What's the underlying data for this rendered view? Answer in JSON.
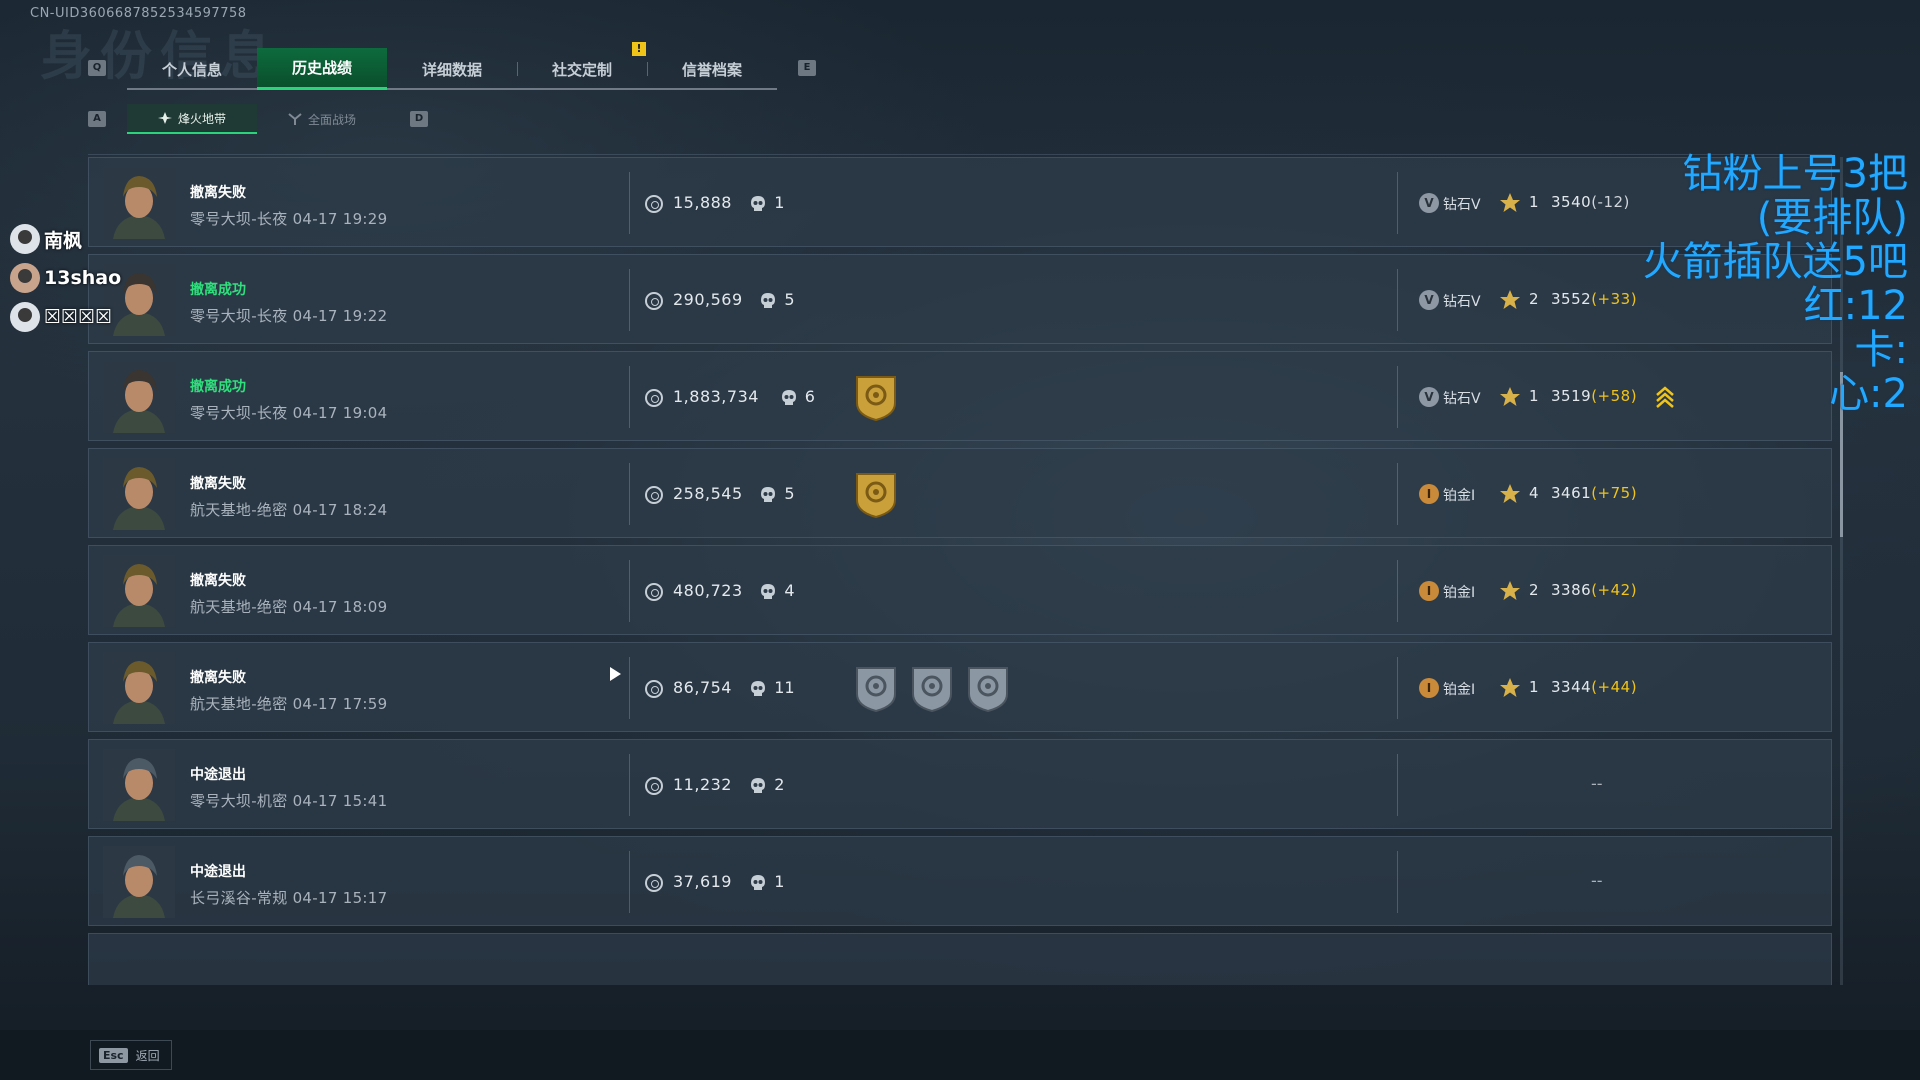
{
  "uid": "CN-UID3606687852534597758",
  "tabs": {
    "key_left": "Q",
    "key_right": "E",
    "items": [
      {
        "label": "个人信息"
      },
      {
        "label": "历史战绩"
      },
      {
        "label": "详细数据"
      },
      {
        "label": "社交定制"
      },
      {
        "label": "信誉档案"
      }
    ],
    "notice": "!"
  },
  "subtabs": {
    "key_left": "A",
    "key_right": "D",
    "items": [
      {
        "label": "烽火地带"
      },
      {
        "label": "全面战场"
      }
    ]
  },
  "viewers": [
    {
      "name": "南枫"
    },
    {
      "name": "13shao"
    },
    {
      "name": "☒☒☒☒"
    }
  ],
  "stream_overlay": {
    "lines": [
      "钻粉上号3把",
      "(要排队)",
      "火箭插队送5吧",
      "红:12",
      "卡:",
      "心:2"
    ]
  },
  "records": [
    {
      "status": "撤离失败",
      "result": "fail",
      "map_time": "零号大坝-长夜 04-17 19:29",
      "money": "15,888",
      "kills": "1",
      "badges": [],
      "rank": "钻石V",
      "rank_type": "diamond",
      "stars": "1",
      "score": "3540",
      "delta": "(-12)",
      "promoted": false
    },
    {
      "status": "撤离成功",
      "result": "success",
      "map_time": "零号大坝-长夜 04-17 19:22",
      "money": "290,569",
      "kills": "5",
      "badges": [],
      "rank": "钻石V",
      "rank_type": "diamond",
      "stars": "2",
      "score": "3552",
      "delta": "(+33)",
      "promoted": false
    },
    {
      "status": "撤离成功",
      "result": "success",
      "map_time": "零号大坝-长夜 04-17 19:04",
      "money": "1,883,734",
      "kills": "6",
      "badges": [
        "gold-eye-badge"
      ],
      "rank": "钻石V",
      "rank_type": "diamond",
      "stars": "1",
      "score": "3519",
      "delta": "(+58)",
      "promoted": true
    },
    {
      "status": "撤离失败",
      "result": "fail",
      "map_time": "航天基地-绝密 04-17 18:24",
      "money": "258,545",
      "kills": "5",
      "badges": [
        "gold-sun-badge"
      ],
      "rank": "铂金I",
      "rank_type": "platinum",
      "stars": "4",
      "score": "3461",
      "delta": "(+75)",
      "promoted": false
    },
    {
      "status": "撤离失败",
      "result": "fail",
      "map_time": "航天基地-绝密 04-17 18:09",
      "money": "480,723",
      "kills": "4",
      "badges": [],
      "rank": "铂金I",
      "rank_type": "platinum",
      "stars": "2",
      "score": "3386",
      "delta": "(+42)",
      "promoted": false
    },
    {
      "status": "撤离失败",
      "result": "fail",
      "map_time": "航天基地-绝密 04-17 17:59",
      "money": "86,754",
      "kills": "11",
      "badges": [
        "silver-crosshair-badge",
        "silver-skull-badge",
        "silver-star-badge"
      ],
      "rank": "铂金I",
      "rank_type": "platinum",
      "stars": "1",
      "score": "3344",
      "delta": "(+44)",
      "promoted": false
    },
    {
      "status": "中途退出",
      "result": "quit",
      "map_time": "零号大坝-机密 04-17 15:41",
      "money": "11,232",
      "kills": "2",
      "badges": [],
      "rank": "--",
      "rank_type": "none"
    },
    {
      "status": "中途退出",
      "result": "quit",
      "map_time": "长弓溪谷-常规 04-17 15:17",
      "money": "37,619",
      "kills": "1",
      "badges": [],
      "rank": "--",
      "rank_type": "none"
    }
  ],
  "footer": {
    "esc_key": "Esc",
    "back_label": "返回"
  }
}
